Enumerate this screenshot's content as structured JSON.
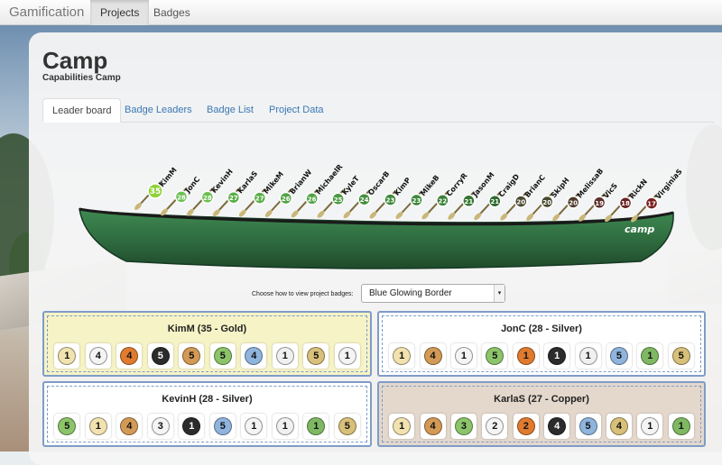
{
  "navbar": {
    "brand": "Gamification",
    "links": [
      "Projects",
      "Badges"
    ],
    "active": "Projects"
  },
  "page": {
    "title": "Camp",
    "subtitle": "Capabilities Camp"
  },
  "tabs": [
    {
      "label": "Leader board",
      "active": true
    },
    {
      "label": "Badge Leaders",
      "active": false
    },
    {
      "label": "Badge List",
      "active": false
    },
    {
      "label": "Project Data",
      "active": false
    }
  ],
  "canoe": {
    "logo": "camp",
    "hull_color": "#2e6a3e",
    "paddlers": [
      {
        "name": "KimM",
        "points": "35",
        "color": "#8fd13a"
      },
      {
        "name": "JonC",
        "points": "28",
        "color": "#6bbf52"
      },
      {
        "name": "KevinH",
        "points": "28",
        "color": "#6bbf52"
      },
      {
        "name": "KarlaS",
        "points": "27",
        "color": "#5cae4a"
      },
      {
        "name": "MikeM",
        "points": "27",
        "color": "#5cae4a"
      },
      {
        "name": "BrianW",
        "points": "26",
        "color": "#52a347"
      },
      {
        "name": "MichaelR",
        "points": "26",
        "color": "#52a347"
      },
      {
        "name": "KyleT",
        "points": "25",
        "color": "#4a9a42"
      },
      {
        "name": "OscarB",
        "points": "24",
        "color": "#44903f"
      },
      {
        "name": "KimP",
        "points": "23",
        "color": "#3e883b"
      },
      {
        "name": "MikeB",
        "points": "23",
        "color": "#3e883b"
      },
      {
        "name": "CorryR",
        "points": "22",
        "color": "#3a7f37"
      },
      {
        "name": "JasonM",
        "points": "21",
        "color": "#367633"
      },
      {
        "name": "CraigD",
        "points": "21",
        "color": "#2f6a2f"
      },
      {
        "name": "BrianC",
        "points": "20",
        "color": "#4a4a30"
      },
      {
        "name": "SkipH",
        "points": "20",
        "color": "#4a4a30"
      },
      {
        "name": "MelissaB",
        "points": "20",
        "color": "#503a2c"
      },
      {
        "name": "VicS",
        "points": "19",
        "color": "#5a2f2a"
      },
      {
        "name": "RickN",
        "points": "18",
        "color": "#6a2525"
      },
      {
        "name": "VirginiaS",
        "points": "17",
        "color": "#7a1e1e"
      }
    ]
  },
  "selector": {
    "label": "Choose how to view project badges:",
    "value": "Blue Glowing Border"
  },
  "cards": [
    {
      "title": "KimM (35 - Gold)",
      "bg": "#f6f3c6",
      "badges": [
        {
          "n": "1",
          "c": "#f1e2b0"
        },
        {
          "n": "4",
          "c": "#f4f4f4"
        },
        {
          "n": "4",
          "c": "#e07b2e"
        },
        {
          "n": "5",
          "c": "#2b2b2b"
        },
        {
          "n": "5",
          "c": "#d39a56"
        },
        {
          "n": "5",
          "c": "#8cc46a"
        },
        {
          "n": "4",
          "c": "#8fb4dd"
        },
        {
          "n": "1",
          "c": "#f0f0f0"
        },
        {
          "n": "5",
          "c": "#d8c07a"
        },
        {
          "n": "1",
          "c": "#f4f4f4"
        }
      ]
    },
    {
      "title": "JonC (28 - Silver)",
      "bg": "#ffffff",
      "badges": [
        {
          "n": "1",
          "c": "#f1e2b0"
        },
        {
          "n": "4",
          "c": "#d39a56"
        },
        {
          "n": "1",
          "c": "#f4f4f4"
        },
        {
          "n": "5",
          "c": "#8cc46a"
        },
        {
          "n": "1",
          "c": "#e07b2e"
        },
        {
          "n": "1",
          "c": "#2b2b2b"
        },
        {
          "n": "1",
          "c": "#f0f0f0"
        },
        {
          "n": "5",
          "c": "#8fb4dd"
        },
        {
          "n": "1",
          "c": "#7fb862"
        },
        {
          "n": "5",
          "c": "#d8c07a"
        }
      ]
    },
    {
      "title": "KevinH (28 - Silver)",
      "bg": "#ffffff",
      "badges": [
        {
          "n": "5",
          "c": "#8cc46a"
        },
        {
          "n": "1",
          "c": "#f1e2b0"
        },
        {
          "n": "4",
          "c": "#d39a56"
        },
        {
          "n": "3",
          "c": "#f4f4f4"
        },
        {
          "n": "1",
          "c": "#2b2b2b"
        },
        {
          "n": "5",
          "c": "#8fb4dd"
        },
        {
          "n": "1",
          "c": "#f4f4f4"
        },
        {
          "n": "1",
          "c": "#f0f0f0"
        },
        {
          "n": "1",
          "c": "#7fb862"
        },
        {
          "n": "5",
          "c": "#d8c07a"
        }
      ]
    },
    {
      "title": "KarlaS (27 - Copper)",
      "bg": "#e4d8cd",
      "badges": [
        {
          "n": "1",
          "c": "#f1e2b0"
        },
        {
          "n": "4",
          "c": "#d39a56"
        },
        {
          "n": "3",
          "c": "#8cc46a"
        },
        {
          "n": "2",
          "c": "#f4f4f4"
        },
        {
          "n": "2",
          "c": "#e07b2e"
        },
        {
          "n": "4",
          "c": "#2b2b2b"
        },
        {
          "n": "5",
          "c": "#8fb4dd"
        },
        {
          "n": "4",
          "c": "#d8c07a"
        },
        {
          "n": "1",
          "c": "#f4f4f4"
        },
        {
          "n": "1",
          "c": "#7fb862"
        }
      ]
    }
  ]
}
